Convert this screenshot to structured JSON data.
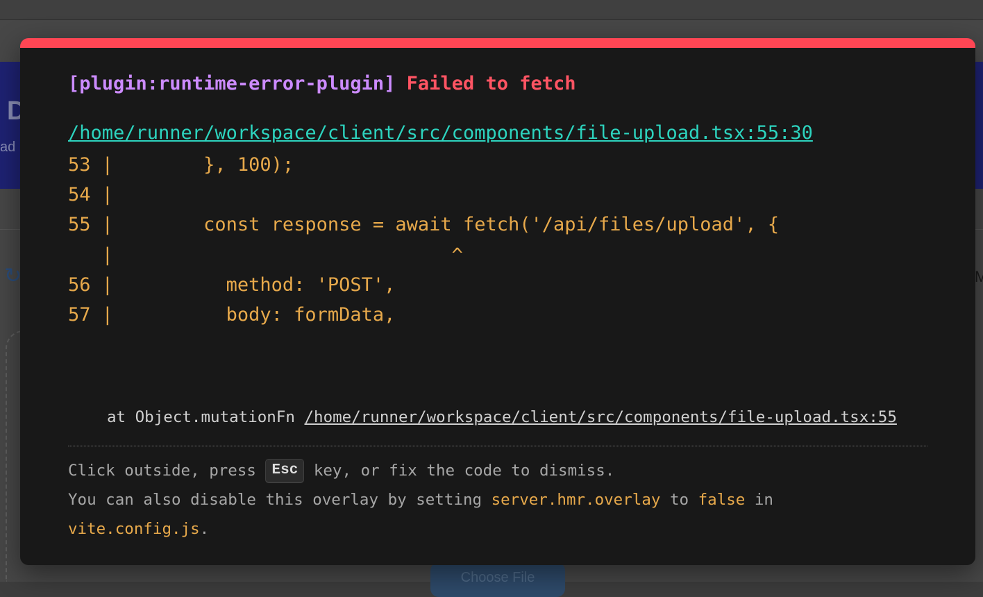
{
  "background": {
    "header_title": "D",
    "header_subtitle": "ad",
    "side_text": "M",
    "choose_file_button": "Choose File"
  },
  "overlay": {
    "plugin": "[plugin:runtime-error-plugin]",
    "message": "Failed to fetch",
    "file": "/home/runner/workspace/client/src/components/file-upload.tsx:55:30",
    "frame": "53 |        }, 100);\n54 |\n55 |        const response = await fetch('/api/files/upload', {\n   |                              ^\n56 |          method: 'POST',\n57 |          body: formData,",
    "stack_prefix": "at Object.mutationFn ",
    "stack_link": "/home/runner/workspace/client/src/components/file-upload.tsx:55",
    "tip_line1_before": "Click outside, press ",
    "tip_key": "Esc",
    "tip_line1_after": " key, or fix the code to dismiss.",
    "tip_line2_before": "You can also disable this overlay by setting ",
    "tip_code_setting": "server.hmr.overlay",
    "tip_line2_middle": " to ",
    "tip_code_false": "false",
    "tip_line2_after": " in",
    "tip_code_file": "vite.config.js",
    "tip_line3_after": "."
  },
  "colors": {
    "accent_bar": "#ff4654",
    "plugin": "#cc8bff",
    "message": "#ff5463",
    "file_link": "#2dd4bf",
    "code": "#e7a94b"
  }
}
